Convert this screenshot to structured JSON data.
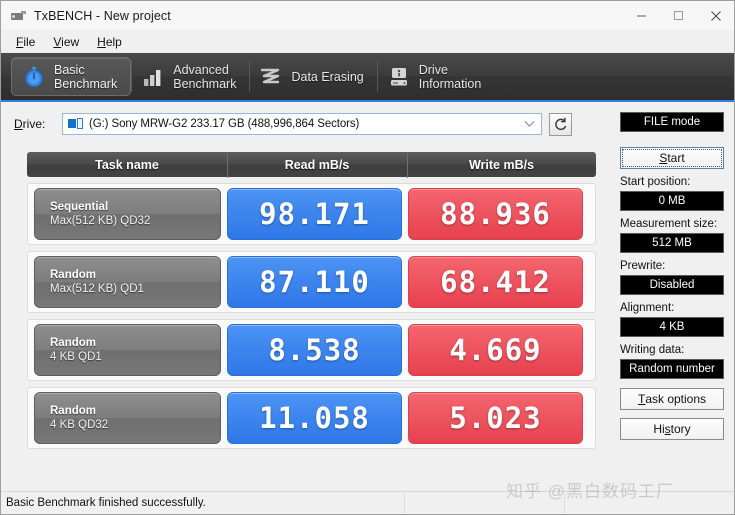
{
  "window": {
    "title": "TxBENCH - New project",
    "app_icon": "usb-device-icon",
    "controls": {
      "minimize": "minimize-icon",
      "maximize": "maximize-icon",
      "close": "close-icon"
    }
  },
  "menubar": {
    "items": [
      "File",
      "View",
      "Help"
    ]
  },
  "tabs": [
    {
      "label": "Basic\nBenchmark",
      "icon": "stopwatch-icon",
      "active": true
    },
    {
      "label": "Advanced\nBenchmark",
      "icon": "bar-chart-icon",
      "active": false
    },
    {
      "label": "Data Erasing",
      "icon": "wave-shred-icon",
      "active": false
    },
    {
      "label": "Drive\nInformation",
      "icon": "hard-drive-icon",
      "active": false
    }
  ],
  "drive": {
    "label": "Drive:",
    "value": "(G:) Sony MRW-G2  233.17 GB (488,996,864 Sectors)",
    "refresh_icon": "refresh-icon",
    "dropdown_icon": "chevron-down-icon"
  },
  "table": {
    "headers": [
      "Task name",
      "Read mB/s",
      "Write mB/s"
    ],
    "rows": [
      {
        "task_line1": "Sequential",
        "task_line2": "Max(512 KB) QD32",
        "read": "98.171",
        "write": "88.936"
      },
      {
        "task_line1": "Random",
        "task_line2": "Max(512 KB) QD1",
        "read": "87.110",
        "write": "68.412"
      },
      {
        "task_line1": "Random",
        "task_line2": "4 KB QD1",
        "read": "8.538",
        "write": "4.669"
      },
      {
        "task_line1": "Random",
        "task_line2": "4 KB QD32",
        "read": "11.058",
        "write": "5.023"
      }
    ]
  },
  "sidebar": {
    "mode_button": "FILE mode",
    "start_button": "Start",
    "start_position_label": "Start position:",
    "start_position_value": "0 MB",
    "measurement_size_label": "Measurement size:",
    "measurement_size_value": "512 MB",
    "prewrite_label": "Prewrite:",
    "prewrite_value": "Disabled",
    "alignment_label": "Alignment:",
    "alignment_value": "4 KB",
    "writing_data_label": "Writing data:",
    "writing_data_value": "Random number",
    "task_options_button": "Task options",
    "history_button": "History"
  },
  "statusbar": {
    "message": "Basic Benchmark finished successfully.",
    "cell2": "",
    "cell3": ""
  },
  "watermark": "知乎 @黑白数码工厂",
  "colors": {
    "read_blue": "#3e86ee",
    "write_red": "#ee5560",
    "tab_accent": "#2f7fe0",
    "dark_header": "#494949",
    "black_field": "#000000"
  },
  "chart_data": {
    "type": "bar",
    "title": "Basic Benchmark results",
    "categories": [
      "Sequential Max(512 KB) QD32",
      "Random Max(512 KB) QD1",
      "Random 4 KB QD1",
      "Random 4 KB QD32"
    ],
    "series": [
      {
        "name": "Read mB/s",
        "values": [
          98.171,
          87.11,
          8.538,
          11.058
        ],
        "color": "#3e86ee"
      },
      {
        "name": "Write mB/s",
        "values": [
          88.936,
          68.412,
          4.669,
          5.023
        ],
        "color": "#ee5560"
      }
    ],
    "xlabel": "Task name",
    "ylabel": "mB/s",
    "legend": [
      "Read mB/s",
      "Write mB/s"
    ]
  }
}
